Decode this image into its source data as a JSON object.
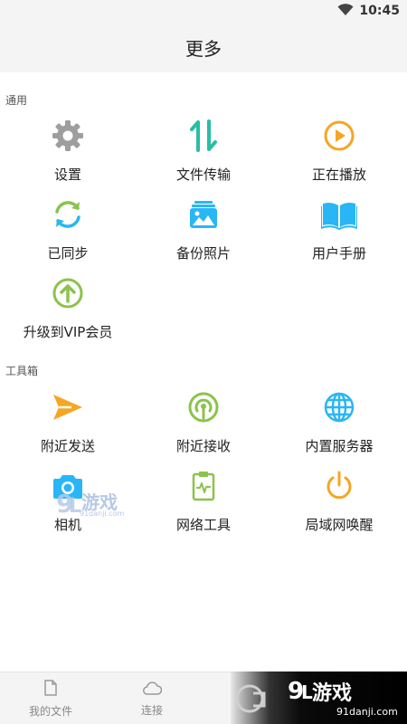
{
  "status_bar": {
    "time": "10:45"
  },
  "header": {
    "title": "更多"
  },
  "sections": [
    {
      "label": "通用",
      "items": [
        {
          "label": "设置",
          "icon": "gear-icon",
          "color": "#9e9e9e"
        },
        {
          "label": "文件传输",
          "icon": "transfer-arrows-icon",
          "color": "#26bfa5"
        },
        {
          "label": "正在播放",
          "icon": "play-circle-icon",
          "color": "#f5a623"
        },
        {
          "label": "已同步",
          "icon": "sync-icon",
          "color": "#29b6f6"
        },
        {
          "label": "备份照片",
          "icon": "photo-backup-icon",
          "color": "#29b6f6"
        },
        {
          "label": "用户手册",
          "icon": "book-icon",
          "color": "#29b6f6"
        },
        {
          "label": "升级到VIP会员",
          "icon": "upgrade-arrow-icon",
          "color": "#8bc34a"
        }
      ]
    },
    {
      "label": "工具箱",
      "items": [
        {
          "label": "附近发送",
          "icon": "send-icon",
          "color": "#f5a623"
        },
        {
          "label": "附近接收",
          "icon": "receive-signal-icon",
          "color": "#8bc34a"
        },
        {
          "label": "内置服务器",
          "icon": "globe-icon",
          "color": "#29b6f6"
        },
        {
          "label": "相机",
          "icon": "camera-icon",
          "color": "#29b6f6"
        },
        {
          "label": "网络工具",
          "icon": "clipboard-pulse-icon",
          "color": "#8bc34a"
        },
        {
          "label": "局域网唤醒",
          "icon": "power-icon",
          "color": "#f5a623"
        }
      ]
    }
  ],
  "bottom_nav": [
    {
      "label": "我的文件",
      "icon": "file-icon"
    },
    {
      "label": "连接",
      "icon": "cloud-icon"
    }
  ],
  "watermark": {
    "brand": "游戏",
    "site": "91danji.com"
  },
  "overlay": {
    "brand": "游戏",
    "site": "91danji.com"
  }
}
